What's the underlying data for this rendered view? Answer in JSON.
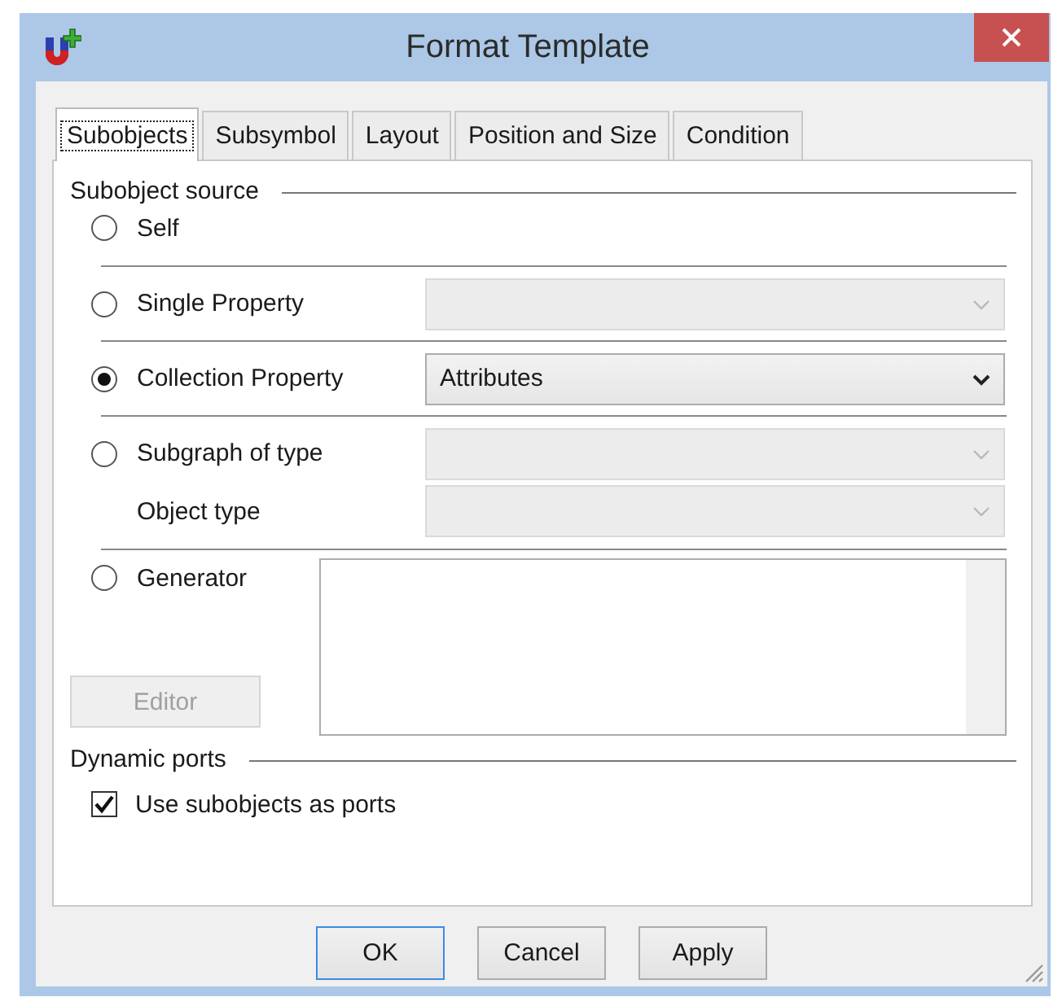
{
  "window": {
    "title": "Format Template"
  },
  "tabs": [
    {
      "label": "Subobjects",
      "selected": true
    },
    {
      "label": "Subsymbol",
      "selected": false
    },
    {
      "label": "Layout",
      "selected": false
    },
    {
      "label": "Position and Size",
      "selected": false
    },
    {
      "label": "Condition",
      "selected": false
    }
  ],
  "subobject_source": {
    "title": "Subobject source",
    "options": [
      {
        "kind": "radio",
        "label": "Self",
        "selected": false
      },
      {
        "kind": "radio_combo",
        "label": "Single Property",
        "selected": false,
        "combo": {
          "disabled": true
        }
      },
      {
        "kind": "radio_combo",
        "label": "Collection Property",
        "selected": true,
        "combo": {
          "value": "Attributes",
          "disabled": false
        }
      },
      {
        "kind": "radio_combo",
        "label": "Subgraph of type",
        "selected": false,
        "combo": {
          "disabled": true
        }
      },
      {
        "kind": "sub_combo",
        "label": "Object type",
        "combo": {
          "disabled": true
        }
      },
      {
        "kind": "generator",
        "label": "Generator",
        "selected": false,
        "editor_button": {
          "label": "Editor",
          "disabled": true
        }
      }
    ]
  },
  "dynamic_ports": {
    "title": "Dynamic ports",
    "checkbox": {
      "label": "Use subobjects as ports",
      "checked": true
    }
  },
  "buttons": [
    {
      "label": "OK",
      "default": true
    },
    {
      "label": "Cancel",
      "default": false
    },
    {
      "label": "Apply",
      "default": false
    }
  ]
}
